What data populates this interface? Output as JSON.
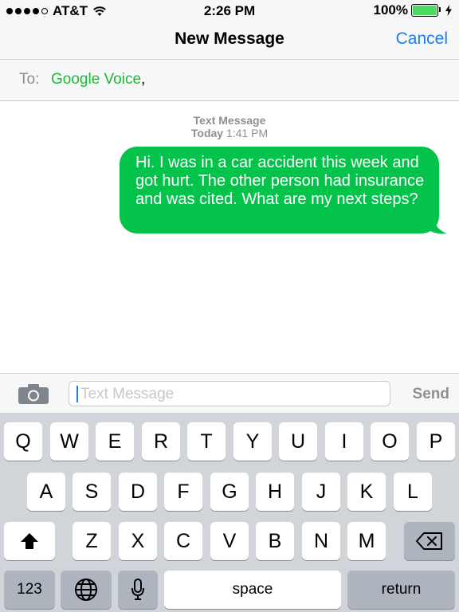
{
  "status": {
    "carrier": "AT&T",
    "time": "2:26 PM",
    "battery": "100%",
    "battery_level": 1.0
  },
  "nav": {
    "title": "New Message",
    "cancel": "Cancel"
  },
  "to": {
    "label": "To:",
    "recipient": "Google Voice",
    "separator": ","
  },
  "thread": {
    "meta_service": "Text Message",
    "meta_day": "Today",
    "meta_time": "1:41 PM",
    "message": "Hi. I was in a car accident this week and got hurt. The other person had insurance and was cited. What are my next steps?"
  },
  "input": {
    "placeholder": "Text Message",
    "send": "Send"
  },
  "keyboard": {
    "row1": [
      "Q",
      "W",
      "E",
      "R",
      "T",
      "Y",
      "U",
      "I",
      "O",
      "P"
    ],
    "row2": [
      "A",
      "S",
      "D",
      "F",
      "G",
      "H",
      "J",
      "K",
      "L"
    ],
    "row3": [
      "Z",
      "X",
      "C",
      "V",
      "B",
      "N",
      "M"
    ],
    "numbers": "123",
    "space": "space",
    "return": "return"
  },
  "colors": {
    "imessage_green": "#04c34b",
    "ios_blue": "#1a7cf6",
    "recipient_green": "#1fb83a",
    "keyboard_bg": "#d1d4d9"
  },
  "icons": [
    "wifi-icon",
    "battery-icon",
    "charging-icon",
    "camera-icon",
    "shift-icon",
    "delete-icon",
    "globe-icon",
    "microphone-icon"
  ]
}
